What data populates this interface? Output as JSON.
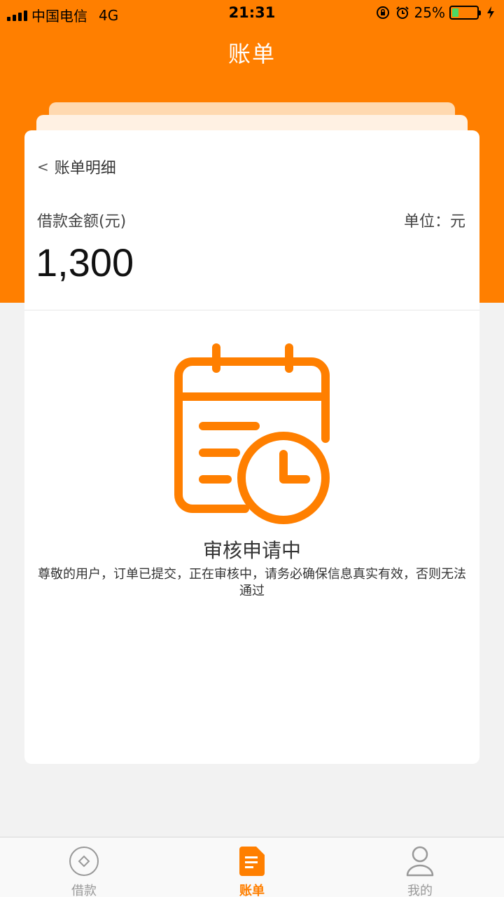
{
  "status_bar": {
    "carrier": "中国电信",
    "network": "4G",
    "time": "21:31",
    "battery": "25%",
    "battery_level": 0.25
  },
  "nav": {
    "title": "账单"
  },
  "card": {
    "back_label": "账单明细",
    "amount_label": "借款金额(元)",
    "unit_label": "单位：元",
    "amount": "1,300",
    "status_title": "审核申请中",
    "status_desc": "尊敬的用户，订单已提交，正在审核中，请务必确保信息真实有效，否则无法通过"
  },
  "tabs": [
    {
      "label": "借款",
      "icon": "loan-icon",
      "active": false
    },
    {
      "label": "账单",
      "icon": "bill-icon",
      "active": true
    },
    {
      "label": "我的",
      "icon": "user-icon",
      "active": false
    }
  ],
  "colors": {
    "accent": "#ff7f00",
    "background": "#f2f2f2"
  }
}
